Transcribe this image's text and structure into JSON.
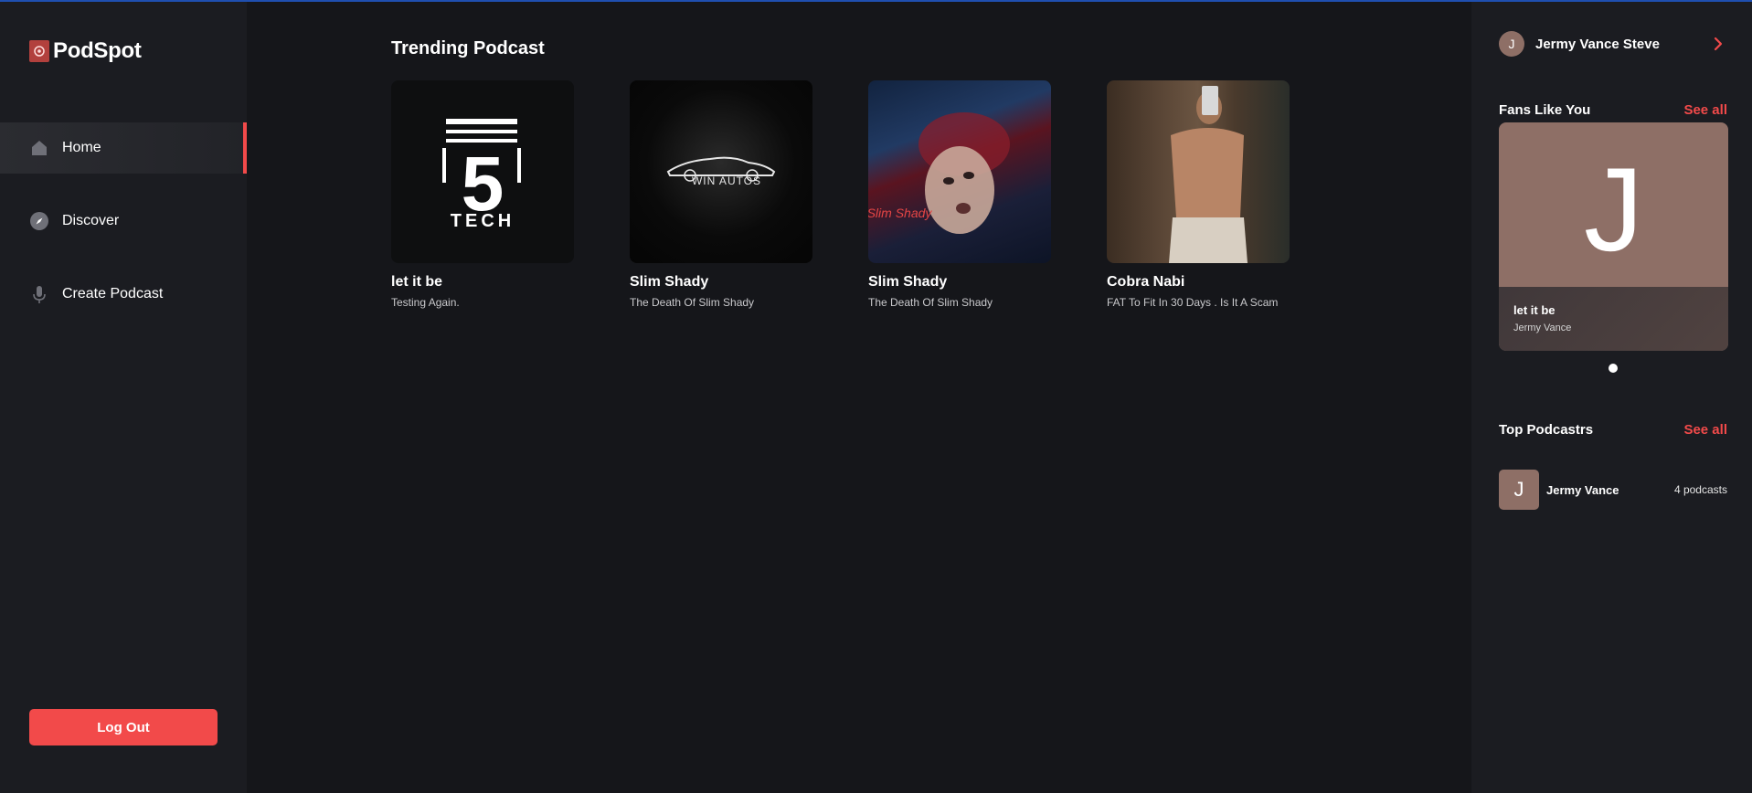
{
  "app": {
    "name": "PodSpot"
  },
  "sidebar": {
    "items": [
      {
        "label": "Home",
        "icon": "home-icon",
        "active": true
      },
      {
        "label": "Discover",
        "icon": "compass-icon",
        "active": false
      },
      {
        "label": "Create Podcast",
        "icon": "microphone-icon",
        "active": false
      }
    ],
    "logout_label": "Log Out"
  },
  "main": {
    "section_title": "Trending Podcast",
    "podcasts": [
      {
        "title": "let it be",
        "subtitle": "Testing Again.",
        "cover_text_top": "5",
        "cover_text_bottom": "TECH"
      },
      {
        "title": "Slim Shady",
        "subtitle": "The Death Of Slim Shady",
        "cover_text": "WIN AUTOS"
      },
      {
        "title": "Slim Shady",
        "subtitle": "The Death Of Slim Shady",
        "cover_text": "Slim Shady"
      },
      {
        "title": "Cobra Nabi",
        "subtitle": "FAT To Fit In 30 Days . Is It A Scam"
      }
    ]
  },
  "right": {
    "user": {
      "initial": "J",
      "name": "Jermy Vance Steve"
    },
    "fans": {
      "title": "Fans Like You",
      "see_all": "See all",
      "card": {
        "initial": "J",
        "title": "let it be",
        "author": "Jermy Vance"
      }
    },
    "top": {
      "title": "Top Podcastrs",
      "see_all": "See all",
      "items": [
        {
          "initial": "J",
          "name": "Jermy Vance",
          "count": "4 podcasts"
        }
      ]
    }
  },
  "colors": {
    "accent": "#f24a4a",
    "background": "#15161a",
    "panel": "#1b1c21",
    "avatar": "#8e6f66"
  }
}
